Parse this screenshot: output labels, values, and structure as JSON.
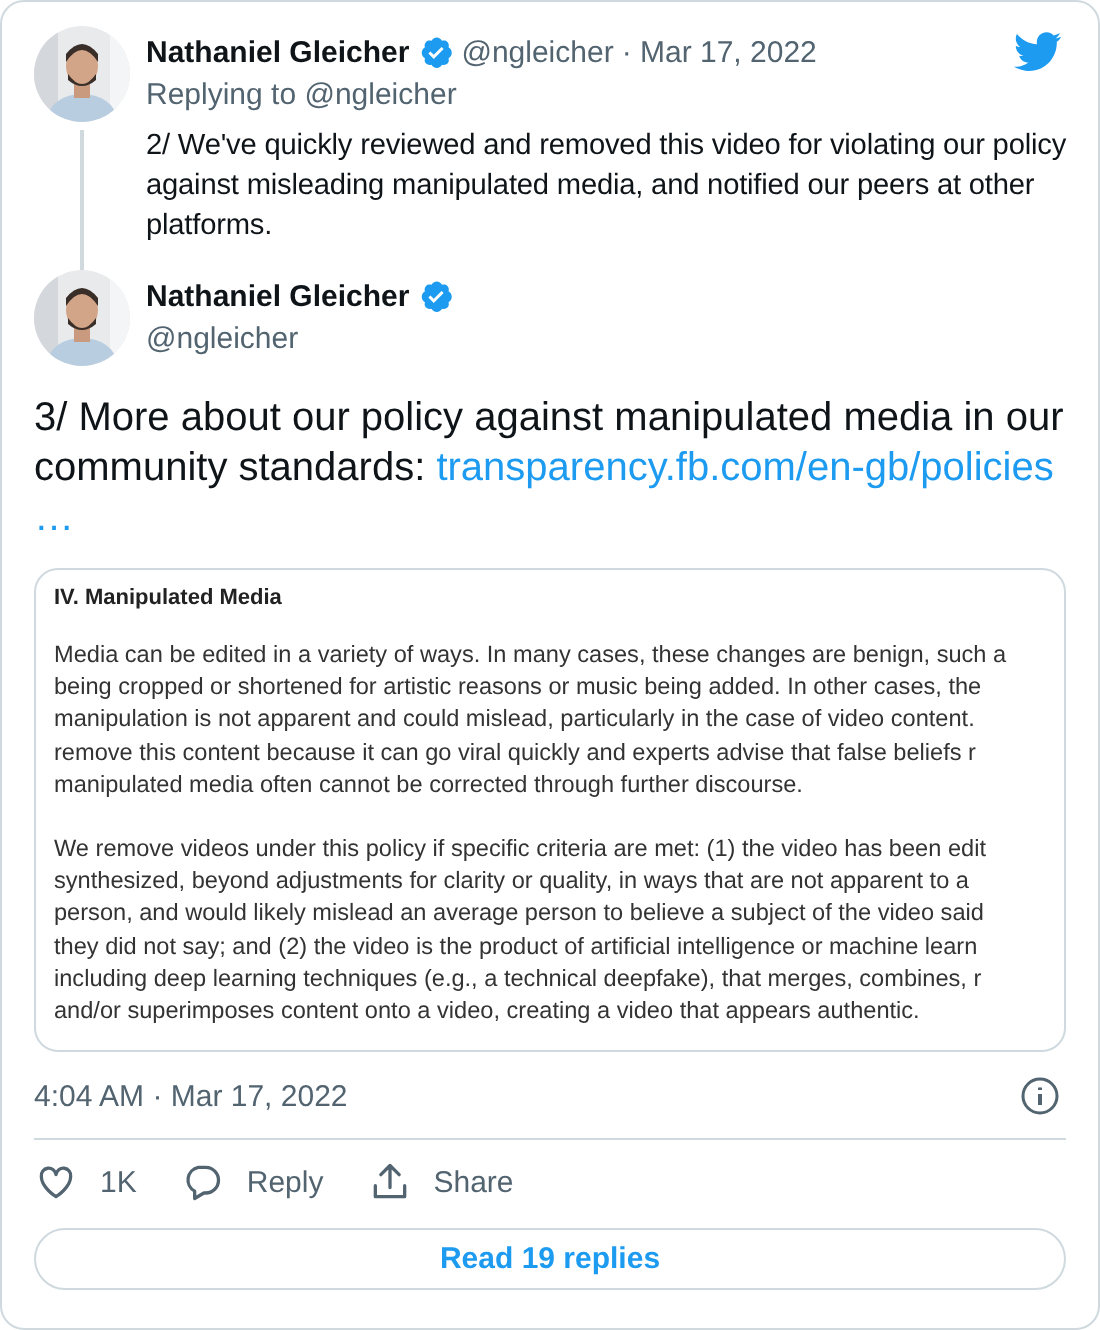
{
  "parent_tweet": {
    "author_name": "Nathaniel Gleicher",
    "verified": true,
    "handle": "@ngleicher",
    "date": "· Mar 17, 2022",
    "replying_to": "Replying to @ngleicher",
    "text": "2/ We've quickly reviewed and removed this video for violating our policy against misleading manipulated media, and notified our peers at other platforms."
  },
  "tweet": {
    "author_name": "Nathaniel Gleicher",
    "verified": true,
    "handle": "@ngleicher",
    "text": "3/ More about our policy against manipulated media in our community standards: ",
    "link": "transparency.fb.com/en-gb/policies",
    "link_ellipsis": "…",
    "document": {
      "heading": "IV. Manipulated Media",
      "paragraphs": [
        [
          "Media can be edited in a variety of ways. In many cases, these changes are benign, such a",
          "being cropped or shortened for artistic reasons or music being added. In other cases, the",
          "manipulation is not apparent and could mislead, particularly in the case of video content.",
          "remove this content because it can go viral quickly and experts advise that false beliefs r",
          "manipulated media often cannot be corrected through further discourse."
        ],
        [
          "We remove videos under this policy if specific criteria are met: (1) the video has been edit",
          "synthesized, beyond adjustments for clarity or quality, in ways that are not apparent to a",
          "person, and would likely mislead an average person to believe a subject of the video said",
          "they did not say; and (2) the video is the product of artificial intelligence or machine learn",
          "including deep learning techniques (e.g., a technical deepfake), that merges, combines, r",
          "and/or superimposes content onto a video, creating a video that appears authentic."
        ]
      ]
    },
    "timestamp": "4:04 AM · Mar 17, 2022",
    "actions": [
      {
        "kind": "like",
        "label": "1K"
      },
      {
        "kind": "reply",
        "label": "Reply"
      },
      {
        "kind": "share",
        "label": "Share"
      }
    ],
    "read_replies": "Read 19 replies"
  }
}
